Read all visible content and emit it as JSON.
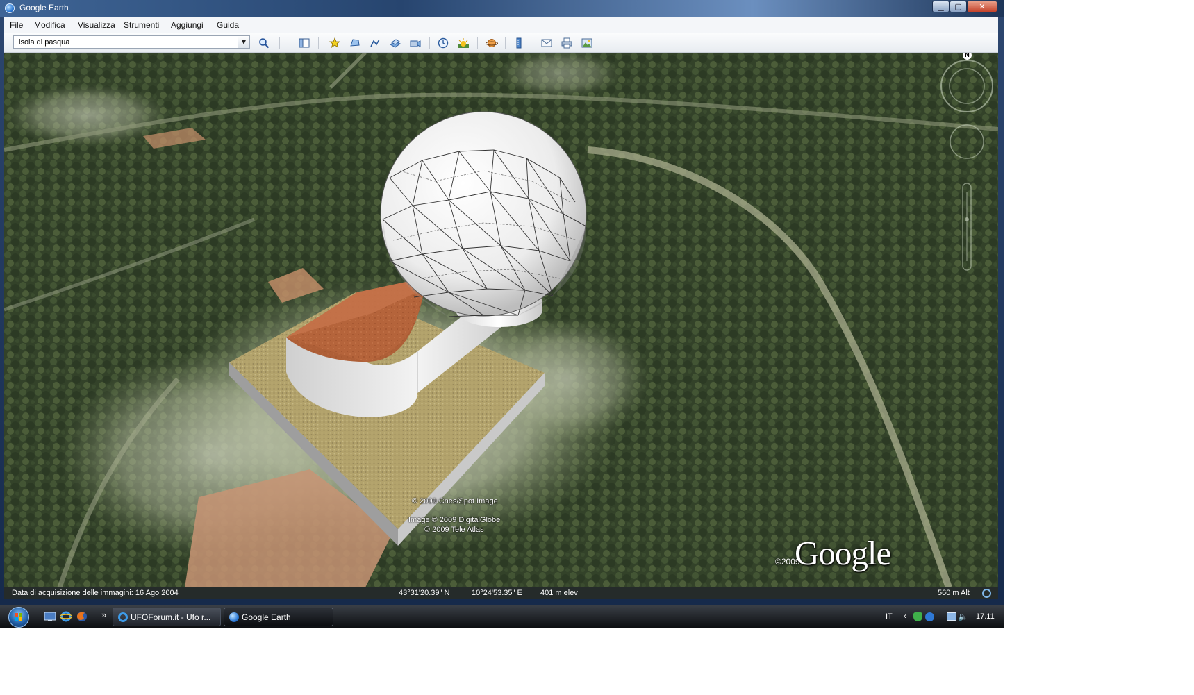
{
  "window": {
    "title": "Google Earth"
  },
  "menu": [
    "File",
    "Modifica",
    "Visualizza",
    "Strumenti",
    "Aggiungi",
    "Guida"
  ],
  "search": {
    "value": "isola di pasqua"
  },
  "toolbar_icons": [
    "search-icon",
    "sidebar-toggle-icon",
    "add-placemark-icon",
    "add-polygon-icon",
    "add-path-icon",
    "add-image-overlay-icon",
    "record-tour-icon",
    "historical-imagery-icon",
    "sunlight-icon",
    "planet-switch-icon",
    "ruler-icon",
    "email-icon",
    "print-icon",
    "save-image-icon"
  ],
  "viewport": {
    "attribution_1": "© 2009 Cnes/Spot Image",
    "attribution_2": "Image © 2009 DigitalGlobe",
    "attribution_3": "© 2009 Tele Atlas",
    "logo": "Google",
    "logo_year": "©2009",
    "compass_north": "N"
  },
  "status": {
    "imagery_date": "Data di acquisizione delle immagini: 16 Ago 2004",
    "latitude": "43°31'20.39\" N",
    "longitude": "10°24'53.35\" E",
    "elevation": "401 m elev",
    "eye_altitude": "560 m Alt"
  },
  "taskbar": {
    "items": [
      {
        "label": "UFOForum.it - Ufo r...",
        "active": false
      },
      {
        "label": "Google Earth",
        "active": true
      }
    ],
    "overflow": "»",
    "language": "IT",
    "time": "17.11"
  },
  "colors": {
    "titlebar": "#27456f",
    "roof": "#b5643b",
    "base": "#b4a46a",
    "dome": "#f2f2f2",
    "forest": "#3b4a2c"
  }
}
